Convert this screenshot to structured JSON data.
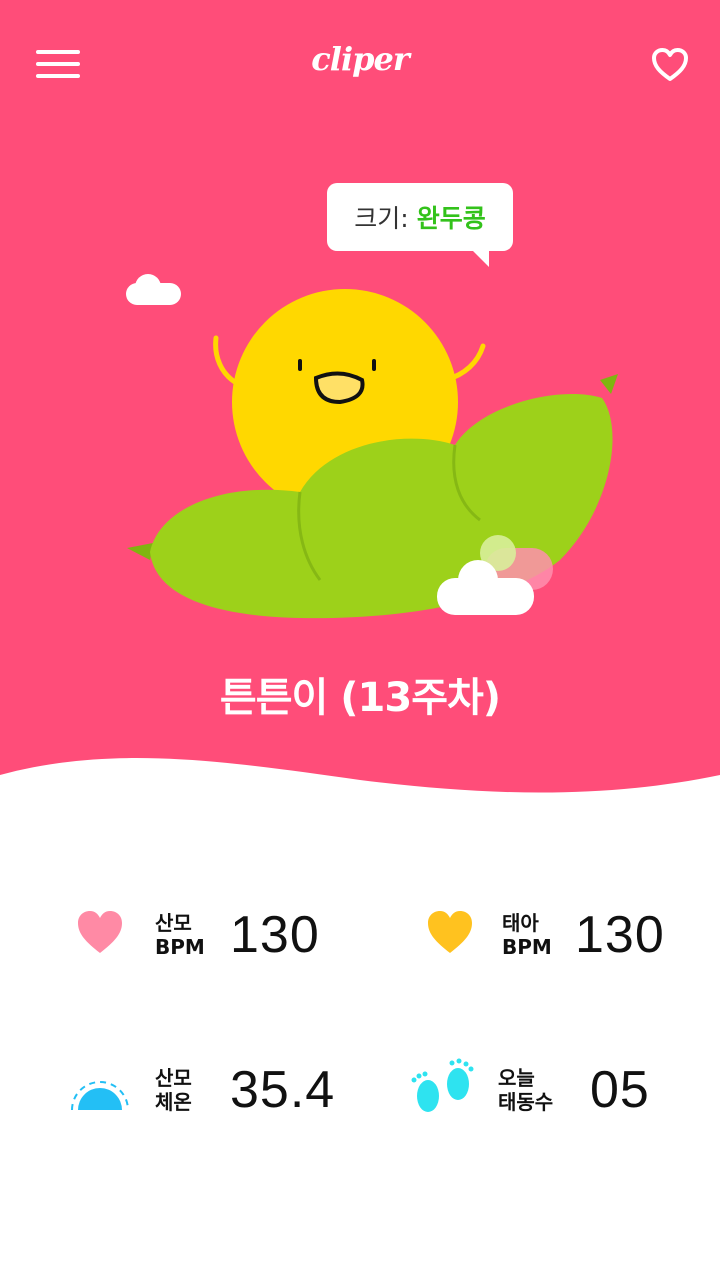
{
  "header": {
    "app_title": "cliper",
    "menu_icon": "hamburger-menu-icon",
    "favorite_icon": "heart-outline-icon"
  },
  "hero": {
    "bubble_label": "크기:",
    "bubble_value": "완두콩",
    "baby_title": "튼튼이 (13주차)",
    "colors": {
      "background": "#ff4d79",
      "pea_pod": "#9dd11a",
      "pea": "#ffd800",
      "bubble_highlight": "#33c21b"
    }
  },
  "stats": {
    "mother_bpm": {
      "label_line1": "산모",
      "label_line2": "BPM",
      "value": "130",
      "icon": "heart-icon",
      "color": "#ff8aa5"
    },
    "fetal_bpm": {
      "label_line1": "태아",
      "label_line2": "BPM",
      "value": "130",
      "icon": "heart-icon",
      "color": "#ffc21f"
    },
    "mother_temp": {
      "label_line1": "산모",
      "label_line2": "체온",
      "value": "35.4",
      "icon": "thermometer-dome-icon",
      "color": "#23bff5"
    },
    "fetal_movement": {
      "label_line1": "오늘",
      "label_line2": "태동수",
      "value": "05",
      "icon": "baby-feet-icon",
      "color": "#2ee3f0"
    }
  }
}
